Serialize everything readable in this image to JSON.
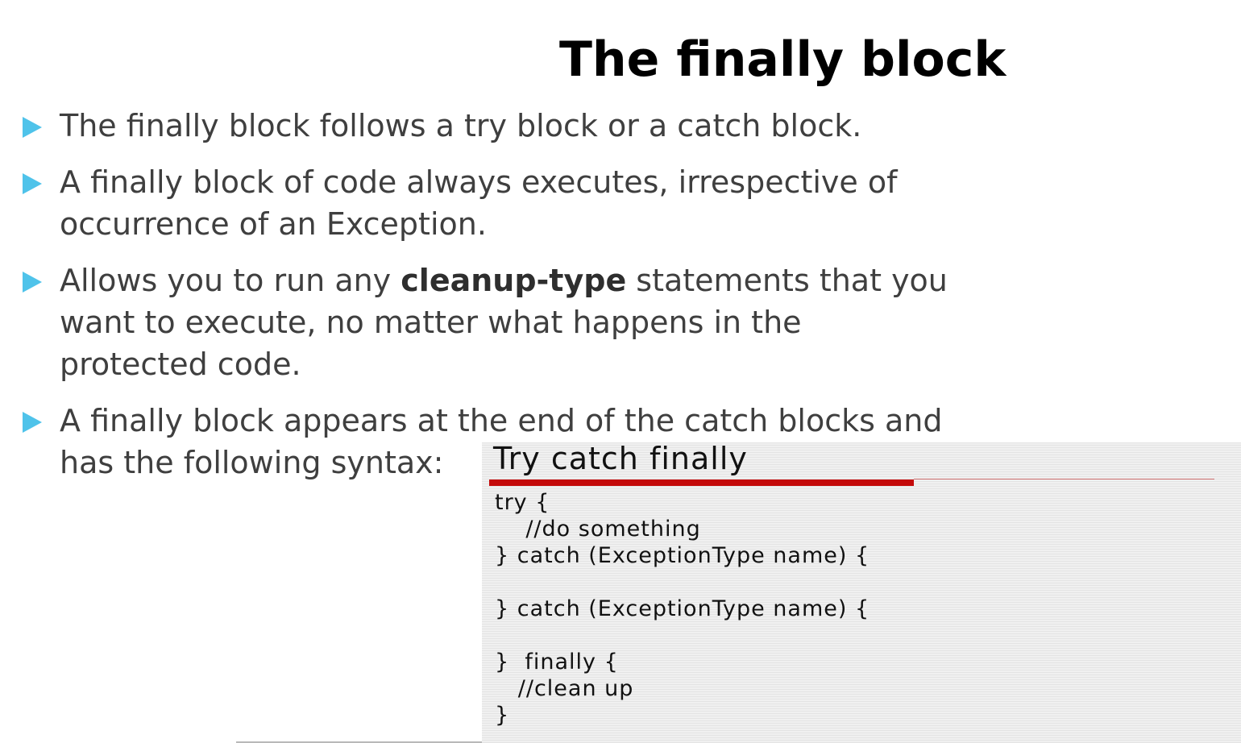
{
  "slide": {
    "title": "The finally block"
  },
  "bullets": {
    "b1": "The finally block follows a try block or a catch block.",
    "b2_line1": "A finally block of code always executes, irrespective of",
    "b2_line2": "occurrence of an Exception.",
    "b3_pre": "Allows you to run any ",
    "b3_bold": "cleanup-type",
    "b3_post": " statements that you",
    "b3_line2": "want to execute, no matter what happens in the",
    "b3_line3": "protected code.",
    "b4_line1": "A finally block appears at the end of the catch blocks and",
    "b4_line2": "has the following syntax:"
  },
  "code_image": {
    "title": "Try catch finally",
    "code": "try {\n    //do something\n} catch (ExceptionType name) {\n\n} catch (ExceptionType name) {\n\n}  finally {\n   //clean up\n}"
  },
  "colors": {
    "bullet_marker": "#4fc3ea",
    "title_text": "#000000",
    "body_text": "#3f3f3f",
    "accent_rule": "#c40a0a"
  }
}
